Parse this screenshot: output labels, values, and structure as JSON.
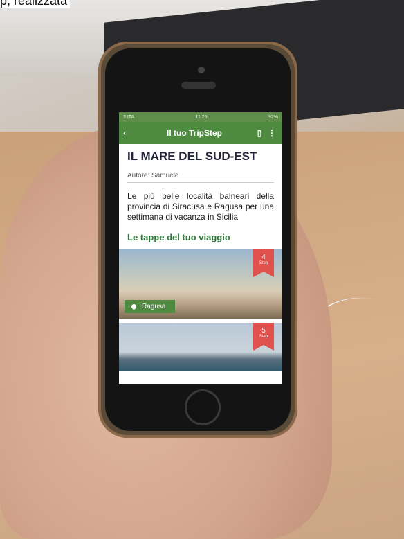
{
  "caption": "p, realizzata",
  "status": {
    "carrier": "3 ITA",
    "time": "11:25",
    "battery": "92%"
  },
  "appbar": {
    "title": "Il tuo TripStep",
    "back_icon": "chevron-left-icon",
    "map_icon": "map-icon",
    "menu_icon": "more-vert-icon"
  },
  "trip": {
    "title": "IL MARE DEL SUD-EST",
    "author": "Autore: Samuele",
    "description": "Le più belle località balneari della provincia di Siracusa e Ragusa per una settimana di vacanza in Sicilia",
    "section": "Le tappe del tuo viaggio"
  },
  "steps": [
    {
      "number": "4",
      "label": "Step",
      "location": "Ragusa"
    },
    {
      "number": "5",
      "label": "Step"
    }
  ],
  "colors": {
    "brand_green": "#4f8a41",
    "bookmark_red": "#e0514e"
  }
}
